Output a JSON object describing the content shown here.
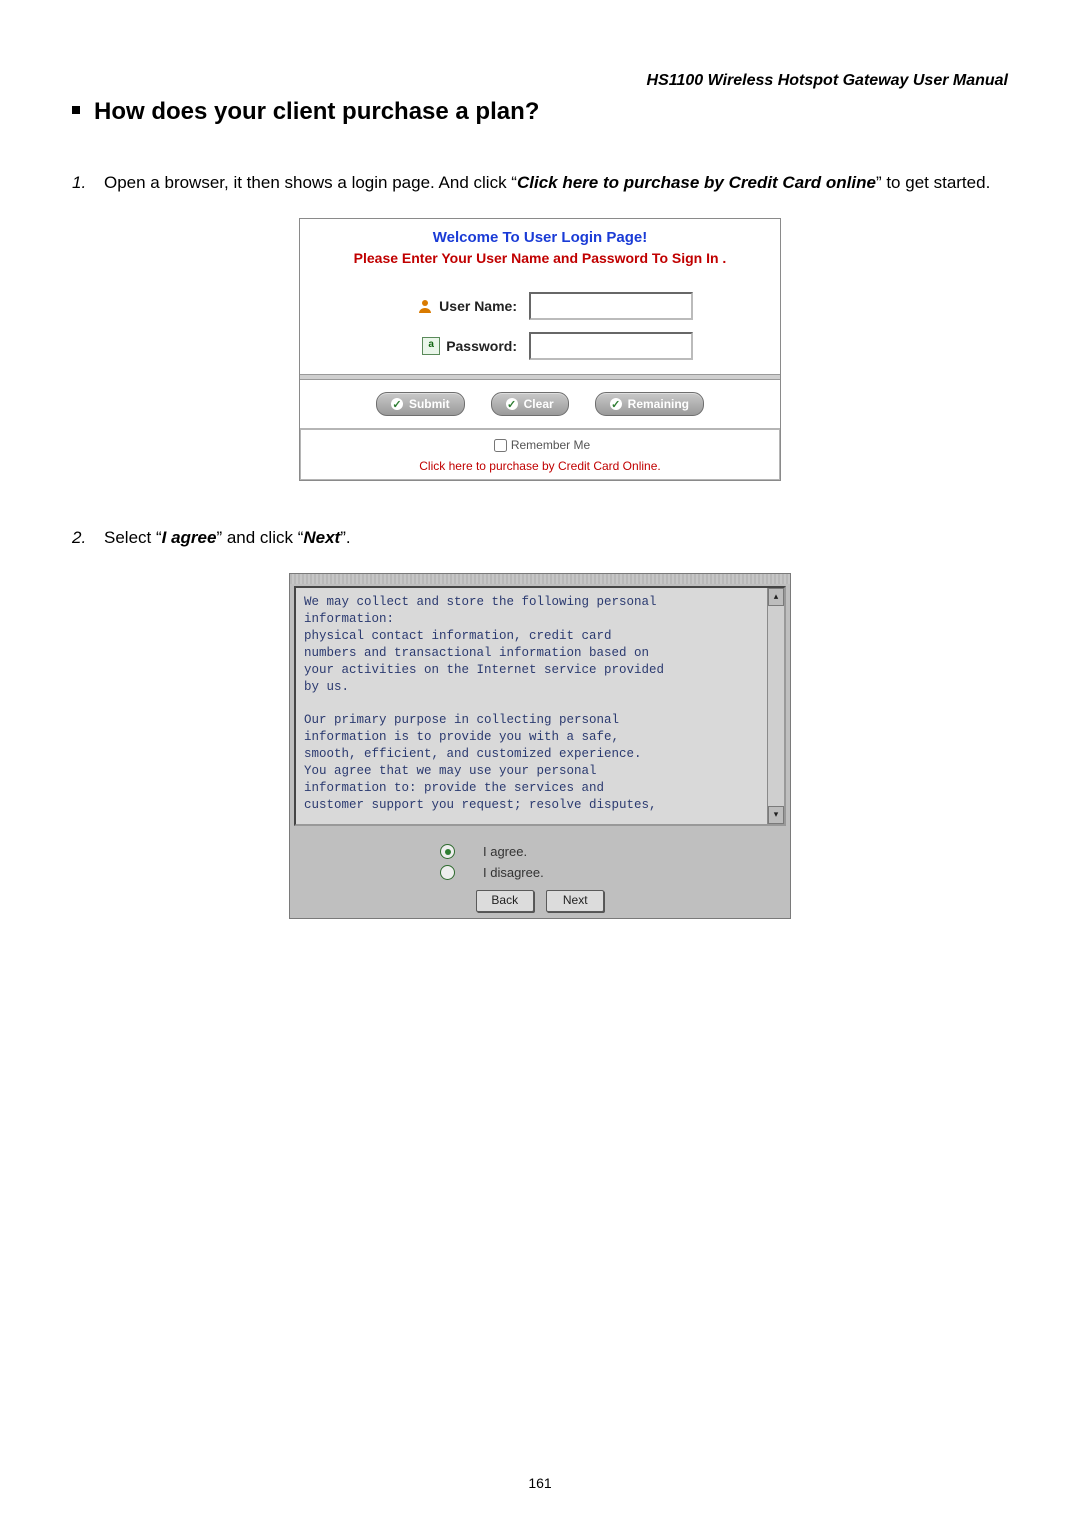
{
  "doc_header": "HS1100 Wireless Hotspot Gateway User Manual",
  "section_heading": "How does your client purchase a plan?",
  "steps": {
    "s1": {
      "num": "1.",
      "pre": "Open a browser, it then shows a login page. And click “",
      "bold": "Click here to purchase by Credit Card online",
      "post": "” to get started."
    },
    "s2": {
      "num": "2.",
      "pre": "Select “",
      "bold1": "I agree",
      "mid": "” and click “",
      "bold2": "Next",
      "post": "”."
    }
  },
  "login": {
    "title": "Welcome To User Login Page!",
    "subtitle": "Please Enter Your User Name and Password To Sign In .",
    "username_label": "User Name:",
    "password_label": "Password:",
    "buttons": {
      "submit": "Submit",
      "clear": "Clear",
      "remaining": "Remaining"
    },
    "remember": "Remember Me",
    "purchase_link": "Click here to purchase by Credit Card Online."
  },
  "agreement": {
    "text": "We may collect and store the following personal\ninformation:\nphysical contact information, credit card\nnumbers and transactional information based on\nyour activities on the Internet service provided\nby us.\n\nOur primary purpose in collecting personal\ninformation is to provide you with a safe,\nsmooth, efficient, and customized experience.\nYou agree that we may use your personal\ninformation to: provide the services and\ncustomer support you request; resolve disputes,",
    "agree": "I agree.",
    "disagree": "I disagree.",
    "back": "Back",
    "next": "Next"
  },
  "page_number": "161"
}
